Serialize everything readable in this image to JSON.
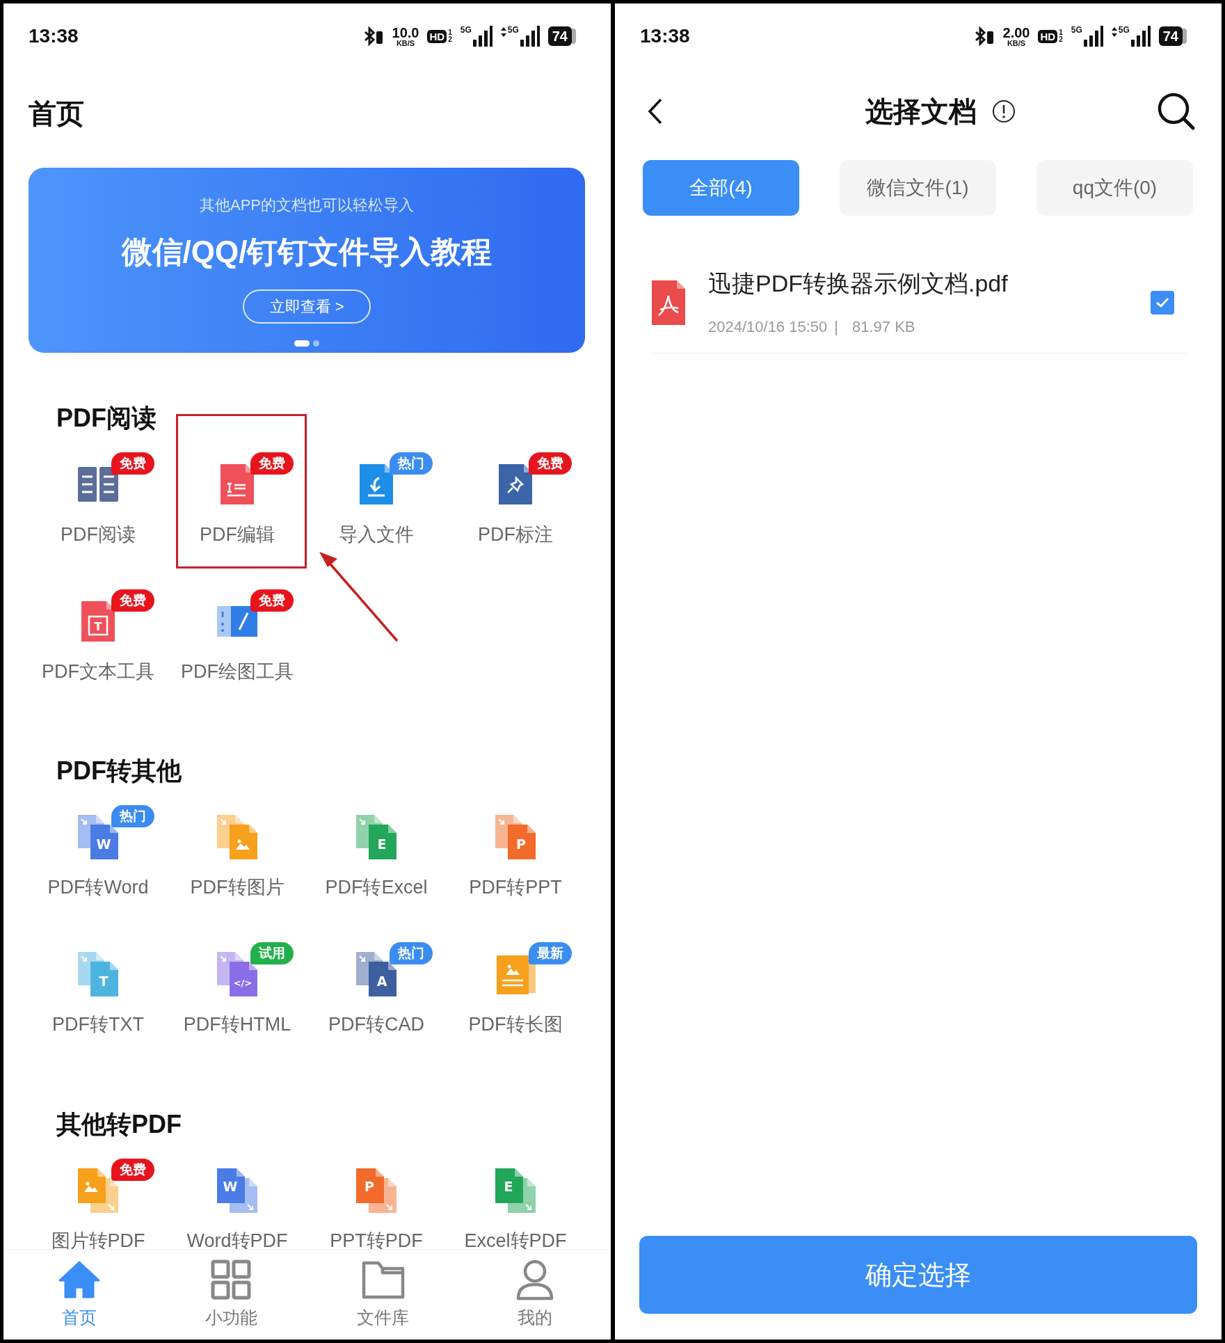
{
  "left_screen": {
    "status_bar": {
      "time": "13:38",
      "speed": "10.0",
      "speed_unit": "KB/S",
      "hd": "HD",
      "sims": [
        "1",
        "2"
      ],
      "signals": [
        {
          "label": "5G",
          "activity": false
        },
        {
          "label": "5G",
          "activity": true
        }
      ],
      "battery": "74"
    },
    "title": "首页",
    "banner": {
      "subtitle": "其他APP的文档也可以轻松导入",
      "headline": "微信/QQ/钉钉文件导入教程",
      "button": "立即查看 >",
      "pages": [
        {
          "selected": true
        },
        {
          "selected": false
        }
      ]
    },
    "sections": [
      {
        "title": "PDF阅读",
        "items": [
          {
            "label": "PDF阅读",
            "badge": {
              "text": "免费",
              "color": "#e8141d"
            },
            "highlighted": false
          },
          {
            "label": "PDF编辑",
            "badge": {
              "text": "免费",
              "color": "#e8141d"
            },
            "highlighted": true
          },
          {
            "label": "导入文件",
            "badge": {
              "text": "热门",
              "color": "#3b8cf0"
            },
            "highlighted": false
          },
          {
            "label": "PDF标注",
            "badge": {
              "text": "免费",
              "color": "#e8141d"
            },
            "highlighted": false
          },
          {
            "label": "PDF文本工具",
            "glyph": "T",
            "badge": {
              "text": "免费",
              "color": "#e8141d"
            },
            "highlighted": false
          },
          {
            "label": "PDF绘图工具",
            "badge": {
              "text": "免费",
              "color": "#e8141d"
            },
            "highlighted": false
          }
        ]
      },
      {
        "title": "PDF转其他",
        "items": [
          {
            "label": "PDF转Word",
            "glyph": "W",
            "badge": {
              "text": "热门",
              "color": "#3b8cf0"
            },
            "highlighted": false
          },
          {
            "label": "PDF转图片",
            "highlighted": false
          },
          {
            "label": "PDF转Excel",
            "glyph": "E",
            "highlighted": false
          },
          {
            "label": "PDF转PPT",
            "glyph": "P",
            "highlighted": false
          },
          {
            "label": "PDF转TXT",
            "glyph": "T",
            "highlighted": false
          },
          {
            "label": "PDF转HTML",
            "glyph": "</>",
            "badge": {
              "text": "试用",
              "color": "#22b04b"
            },
            "highlighted": false
          },
          {
            "label": "PDF转CAD",
            "glyph": "A",
            "badge": {
              "text": "热门",
              "color": "#3b8cf0"
            },
            "highlighted": false
          },
          {
            "label": "PDF转长图",
            "badge": {
              "text": "最新",
              "color": "#3a8ef0"
            },
            "highlighted": false
          }
        ]
      },
      {
        "title": "其他转PDF",
        "items": [
          {
            "label": "图片转PDF",
            "badge": {
              "text": "免费",
              "color": "#e8141d"
            },
            "highlighted": false
          },
          {
            "label": "Word转PDF",
            "glyph": "W",
            "highlighted": false
          },
          {
            "label": "PPT转PDF",
            "glyph": "P",
            "highlighted": false
          },
          {
            "label": "Excel转PDF",
            "glyph": "E",
            "highlighted": false
          }
        ]
      }
    ],
    "nav": [
      {
        "label": "首页",
        "selected": true
      },
      {
        "label": "小功能",
        "selected": false
      },
      {
        "label": "文件库",
        "selected": false
      },
      {
        "label": "我的",
        "selected": false
      }
    ]
  },
  "right_screen": {
    "status_bar": {
      "time": "13:38",
      "speed": "2.00",
      "speed_unit": "KB/S",
      "hd": "HD",
      "sims": [
        "1",
        "2"
      ],
      "signals": [
        {
          "label": "5G",
          "activity": false
        },
        {
          "label": "5G",
          "activity": true
        }
      ],
      "battery": "74"
    },
    "title": "选择文档",
    "tabs": [
      {
        "label": "全部(4)",
        "selected": true
      },
      {
        "label": "微信文件(1)",
        "selected": false
      },
      {
        "label": "qq文件(0)",
        "selected": false
      }
    ],
    "files": [
      {
        "name": "迅捷PDF转换器示例文档.pdf",
        "date": "2024/10/16 15:50",
        "separator": "|",
        "size": "81.97 KB",
        "checked": true
      }
    ],
    "confirm_button": "确定选择"
  }
}
